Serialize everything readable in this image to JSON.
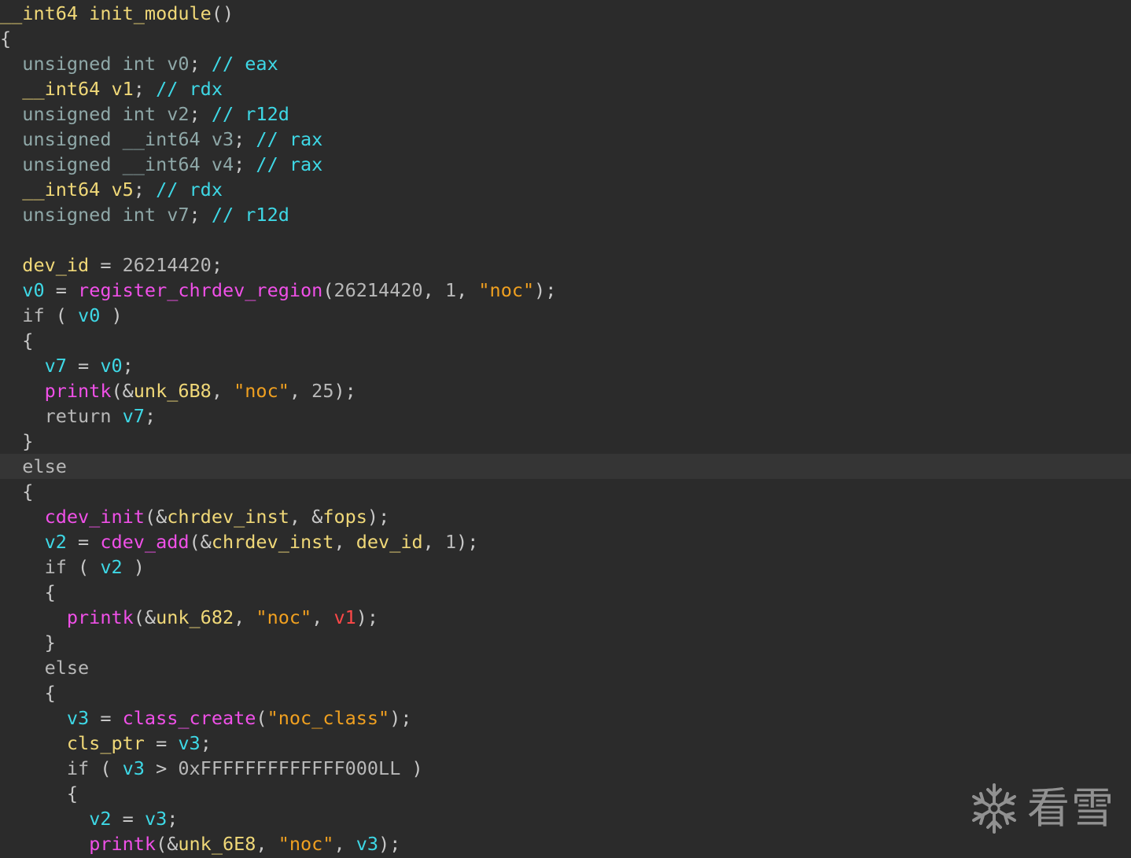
{
  "editor": {
    "title": "__int64 init_module()",
    "lines": [
      {
        "tokens": [
          [
            "sig",
            "__int64 init_module"
          ],
          [
            "p",
            "()"
          ]
        ]
      },
      {
        "tokens": [
          [
            "p",
            "{"
          ]
        ]
      },
      {
        "tokens": [
          [
            "p",
            "  "
          ],
          [
            "type",
            "unsigned int"
          ],
          [
            "p",
            " "
          ],
          [
            "type",
            "v0"
          ],
          [
            "p",
            "; "
          ],
          [
            "cm",
            "// eax"
          ]
        ]
      },
      {
        "tokens": [
          [
            "p",
            "  "
          ],
          [
            "yl",
            "__int64 v1"
          ],
          [
            "p",
            "; "
          ],
          [
            "cm",
            "// rdx"
          ]
        ]
      },
      {
        "tokens": [
          [
            "p",
            "  "
          ],
          [
            "type",
            "unsigned int"
          ],
          [
            "p",
            " "
          ],
          [
            "type",
            "v2"
          ],
          [
            "p",
            "; "
          ],
          [
            "cm",
            "// r12d"
          ]
        ]
      },
      {
        "tokens": [
          [
            "p",
            "  "
          ],
          [
            "type",
            "unsigned __int64"
          ],
          [
            "p",
            " "
          ],
          [
            "type",
            "v3"
          ],
          [
            "p",
            "; "
          ],
          [
            "cm",
            "// rax"
          ]
        ]
      },
      {
        "tokens": [
          [
            "p",
            "  "
          ],
          [
            "type",
            "unsigned __int64"
          ],
          [
            "p",
            " "
          ],
          [
            "type",
            "v4"
          ],
          [
            "p",
            "; "
          ],
          [
            "cm",
            "// rax"
          ]
        ]
      },
      {
        "tokens": [
          [
            "p",
            "  "
          ],
          [
            "yl",
            "__int64 v5"
          ],
          [
            "p",
            "; "
          ],
          [
            "cm",
            "// rdx"
          ]
        ]
      },
      {
        "tokens": [
          [
            "p",
            "  "
          ],
          [
            "type",
            "unsigned int"
          ],
          [
            "p",
            " "
          ],
          [
            "type",
            "v7"
          ],
          [
            "p",
            "; "
          ],
          [
            "cm",
            "// r12d"
          ]
        ]
      },
      {
        "tokens": []
      },
      {
        "tokens": [
          [
            "p",
            "  "
          ],
          [
            "gl",
            "dev_id"
          ],
          [
            "p",
            " = "
          ],
          [
            "num",
            "26214420"
          ],
          [
            "p",
            ";"
          ]
        ]
      },
      {
        "tokens": [
          [
            "p",
            "  "
          ],
          [
            "var",
            "v0"
          ],
          [
            "p",
            " = "
          ],
          [
            "fn",
            "register_chrdev_region"
          ],
          [
            "p",
            "("
          ],
          [
            "num",
            "26214420"
          ],
          [
            "p",
            ", "
          ],
          [
            "num",
            "1"
          ],
          [
            "p",
            ", "
          ],
          [
            "str",
            "\"noc\""
          ],
          [
            "p",
            ");"
          ]
        ]
      },
      {
        "tokens": [
          [
            "p",
            "  "
          ],
          [
            "kw",
            "if"
          ],
          [
            "p",
            " ( "
          ],
          [
            "var",
            "v0"
          ],
          [
            "p",
            " )"
          ]
        ]
      },
      {
        "tokens": [
          [
            "p",
            "  {"
          ]
        ]
      },
      {
        "tokens": [
          [
            "p",
            "    "
          ],
          [
            "var",
            "v7"
          ],
          [
            "p",
            " = "
          ],
          [
            "var",
            "v0"
          ],
          [
            "p",
            ";"
          ]
        ]
      },
      {
        "tokens": [
          [
            "p",
            "    "
          ],
          [
            "fn",
            "printk"
          ],
          [
            "p",
            "(&"
          ],
          [
            "gl",
            "unk_6B8"
          ],
          [
            "p",
            ", "
          ],
          [
            "str",
            "\"noc\""
          ],
          [
            "p",
            ", "
          ],
          [
            "num",
            "25"
          ],
          [
            "p",
            ");"
          ]
        ]
      },
      {
        "tokens": [
          [
            "p",
            "    "
          ],
          [
            "kw",
            "return"
          ],
          [
            "p",
            " "
          ],
          [
            "var",
            "v7"
          ],
          [
            "p",
            ";"
          ]
        ]
      },
      {
        "tokens": [
          [
            "p",
            "  }"
          ]
        ]
      },
      {
        "highlight": true,
        "tokens": [
          [
            "p",
            "  "
          ],
          [
            "kw",
            "else"
          ]
        ]
      },
      {
        "tokens": [
          [
            "p",
            "  {"
          ]
        ]
      },
      {
        "tokens": [
          [
            "p",
            "    "
          ],
          [
            "fn",
            "cdev_init"
          ],
          [
            "p",
            "(&"
          ],
          [
            "gl",
            "chrdev_inst"
          ],
          [
            "p",
            ", &"
          ],
          [
            "gl",
            "fops"
          ],
          [
            "p",
            ");"
          ]
        ]
      },
      {
        "tokens": [
          [
            "p",
            "    "
          ],
          [
            "var",
            "v2"
          ],
          [
            "p",
            " = "
          ],
          [
            "fn",
            "cdev_add"
          ],
          [
            "p",
            "(&"
          ],
          [
            "gl",
            "chrdev_inst"
          ],
          [
            "p",
            ", "
          ],
          [
            "gl",
            "dev_id"
          ],
          [
            "p",
            ", "
          ],
          [
            "num",
            "1"
          ],
          [
            "p",
            ");"
          ]
        ]
      },
      {
        "tokens": [
          [
            "p",
            "    "
          ],
          [
            "kw",
            "if"
          ],
          [
            "p",
            " ( "
          ],
          [
            "var",
            "v2"
          ],
          [
            "p",
            " )"
          ]
        ]
      },
      {
        "tokens": [
          [
            "p",
            "    {"
          ]
        ]
      },
      {
        "tokens": [
          [
            "p",
            "      "
          ],
          [
            "fn",
            "printk"
          ],
          [
            "p",
            "(&"
          ],
          [
            "gl",
            "unk_682"
          ],
          [
            "p",
            ", "
          ],
          [
            "str",
            "\"noc\""
          ],
          [
            "p",
            ", "
          ],
          [
            "red",
            "v1"
          ],
          [
            "p",
            ");"
          ]
        ]
      },
      {
        "tokens": [
          [
            "p",
            "    }"
          ]
        ]
      },
      {
        "tokens": [
          [
            "p",
            "    "
          ],
          [
            "kw",
            "else"
          ]
        ]
      },
      {
        "tokens": [
          [
            "p",
            "    {"
          ]
        ]
      },
      {
        "tokens": [
          [
            "p",
            "      "
          ],
          [
            "var",
            "v3"
          ],
          [
            "p",
            " = "
          ],
          [
            "fn",
            "class_create"
          ],
          [
            "p",
            "("
          ],
          [
            "str",
            "\"noc_class\""
          ],
          [
            "p",
            ");"
          ]
        ]
      },
      {
        "tokens": [
          [
            "p",
            "      "
          ],
          [
            "gl",
            "cls_ptr"
          ],
          [
            "p",
            " = "
          ],
          [
            "var",
            "v3"
          ],
          [
            "p",
            ";"
          ]
        ]
      },
      {
        "tokens": [
          [
            "p",
            "      "
          ],
          [
            "kw",
            "if"
          ],
          [
            "p",
            " ( "
          ],
          [
            "var",
            "v3"
          ],
          [
            "p",
            " > "
          ],
          [
            "num",
            "0xFFFFFFFFFFFFF000LL"
          ],
          [
            "p",
            " )"
          ]
        ]
      },
      {
        "tokens": [
          [
            "p",
            "      {"
          ]
        ]
      },
      {
        "tokens": [
          [
            "p",
            "        "
          ],
          [
            "var",
            "v2"
          ],
          [
            "p",
            " = "
          ],
          [
            "var",
            "v3"
          ],
          [
            "p",
            ";"
          ]
        ]
      },
      {
        "tokens": [
          [
            "p",
            "        "
          ],
          [
            "fn",
            "printk"
          ],
          [
            "p",
            "(&"
          ],
          [
            "gl",
            "unk_6E8"
          ],
          [
            "p",
            ", "
          ],
          [
            "str",
            "\"noc\""
          ],
          [
            "p",
            ", "
          ],
          [
            "var",
            "v3"
          ],
          [
            "p",
            ");"
          ]
        ]
      }
    ]
  },
  "watermark": {
    "text": "看雪",
    "icon": "snowflake-icon"
  },
  "colors": {
    "background": "#2b2b2b",
    "highlight_line": "#353535",
    "function": "#f050e8",
    "string": "#f0a020",
    "variable": "#3ed8e6",
    "global": "#f0d878",
    "error_var": "#ff4848"
  }
}
